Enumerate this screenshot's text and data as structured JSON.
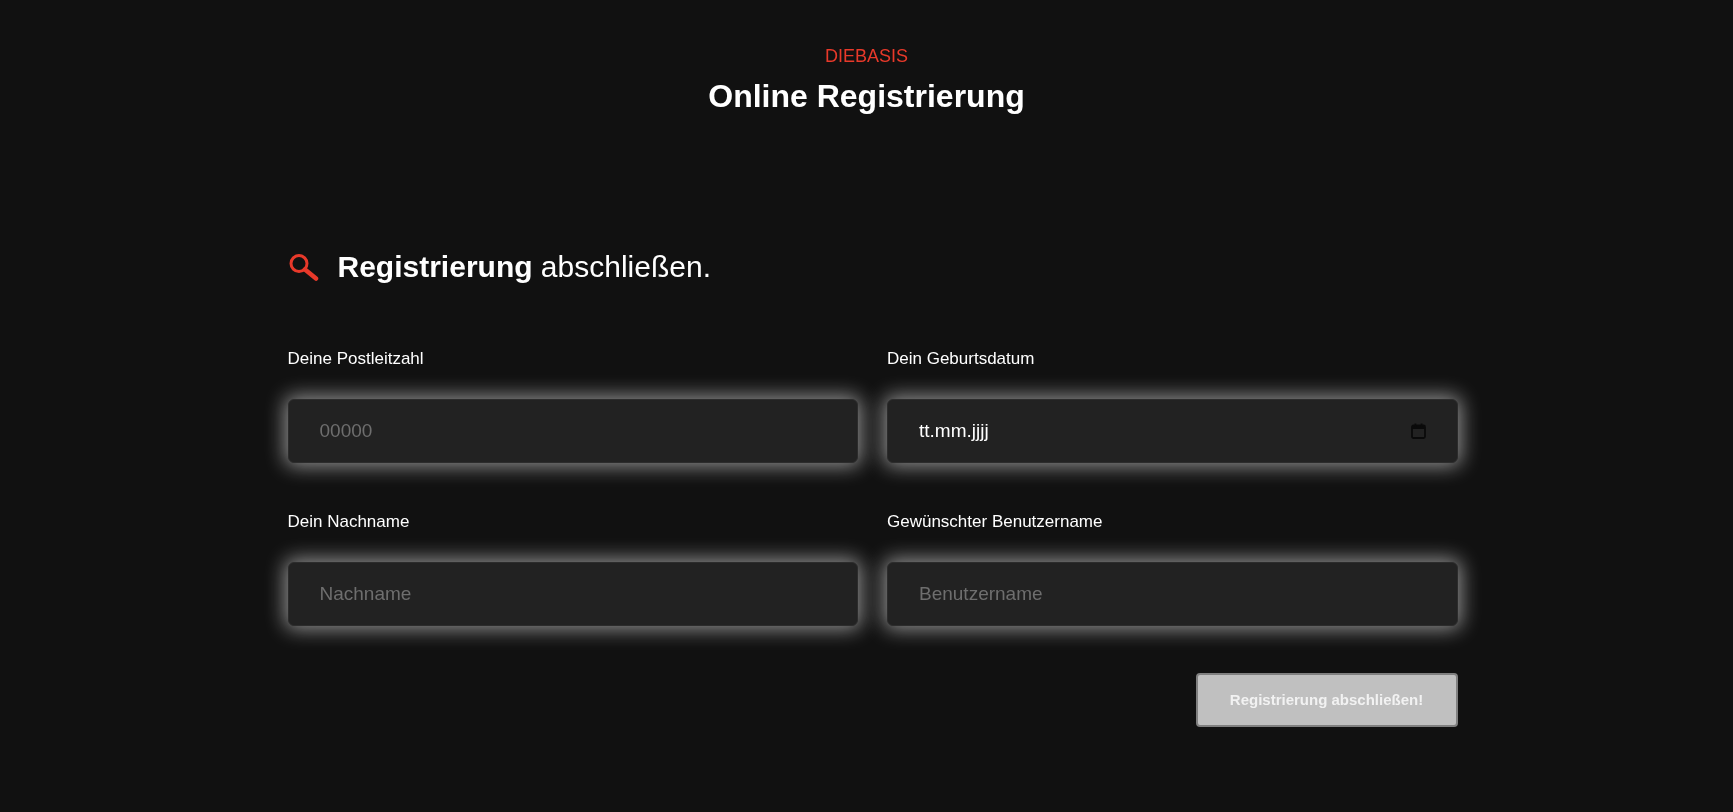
{
  "header": {
    "eyebrow": "DIEBASIS",
    "title": "Online Registrierung"
  },
  "section": {
    "heading": "**Registrierung** abschließen."
  },
  "fields": [
    {
      "kind": "text",
      "label": "Deine Postleitzahl",
      "placeholder": "00000"
    },
    {
      "kind": "date",
      "label": "Dein Geburtsdatum",
      "placeholder": "tt.mm.jjjj"
    },
    {
      "kind": "text",
      "label": "Dein Nachname",
      "placeholder": "Nachname"
    },
    {
      "kind": "text",
      "label": "Gewünschter Benutzername",
      "placeholder": "Benutzername"
    }
  ],
  "submit_button": {
    "label": "Registrierung abschließen!",
    "disabled": true
  }
}
